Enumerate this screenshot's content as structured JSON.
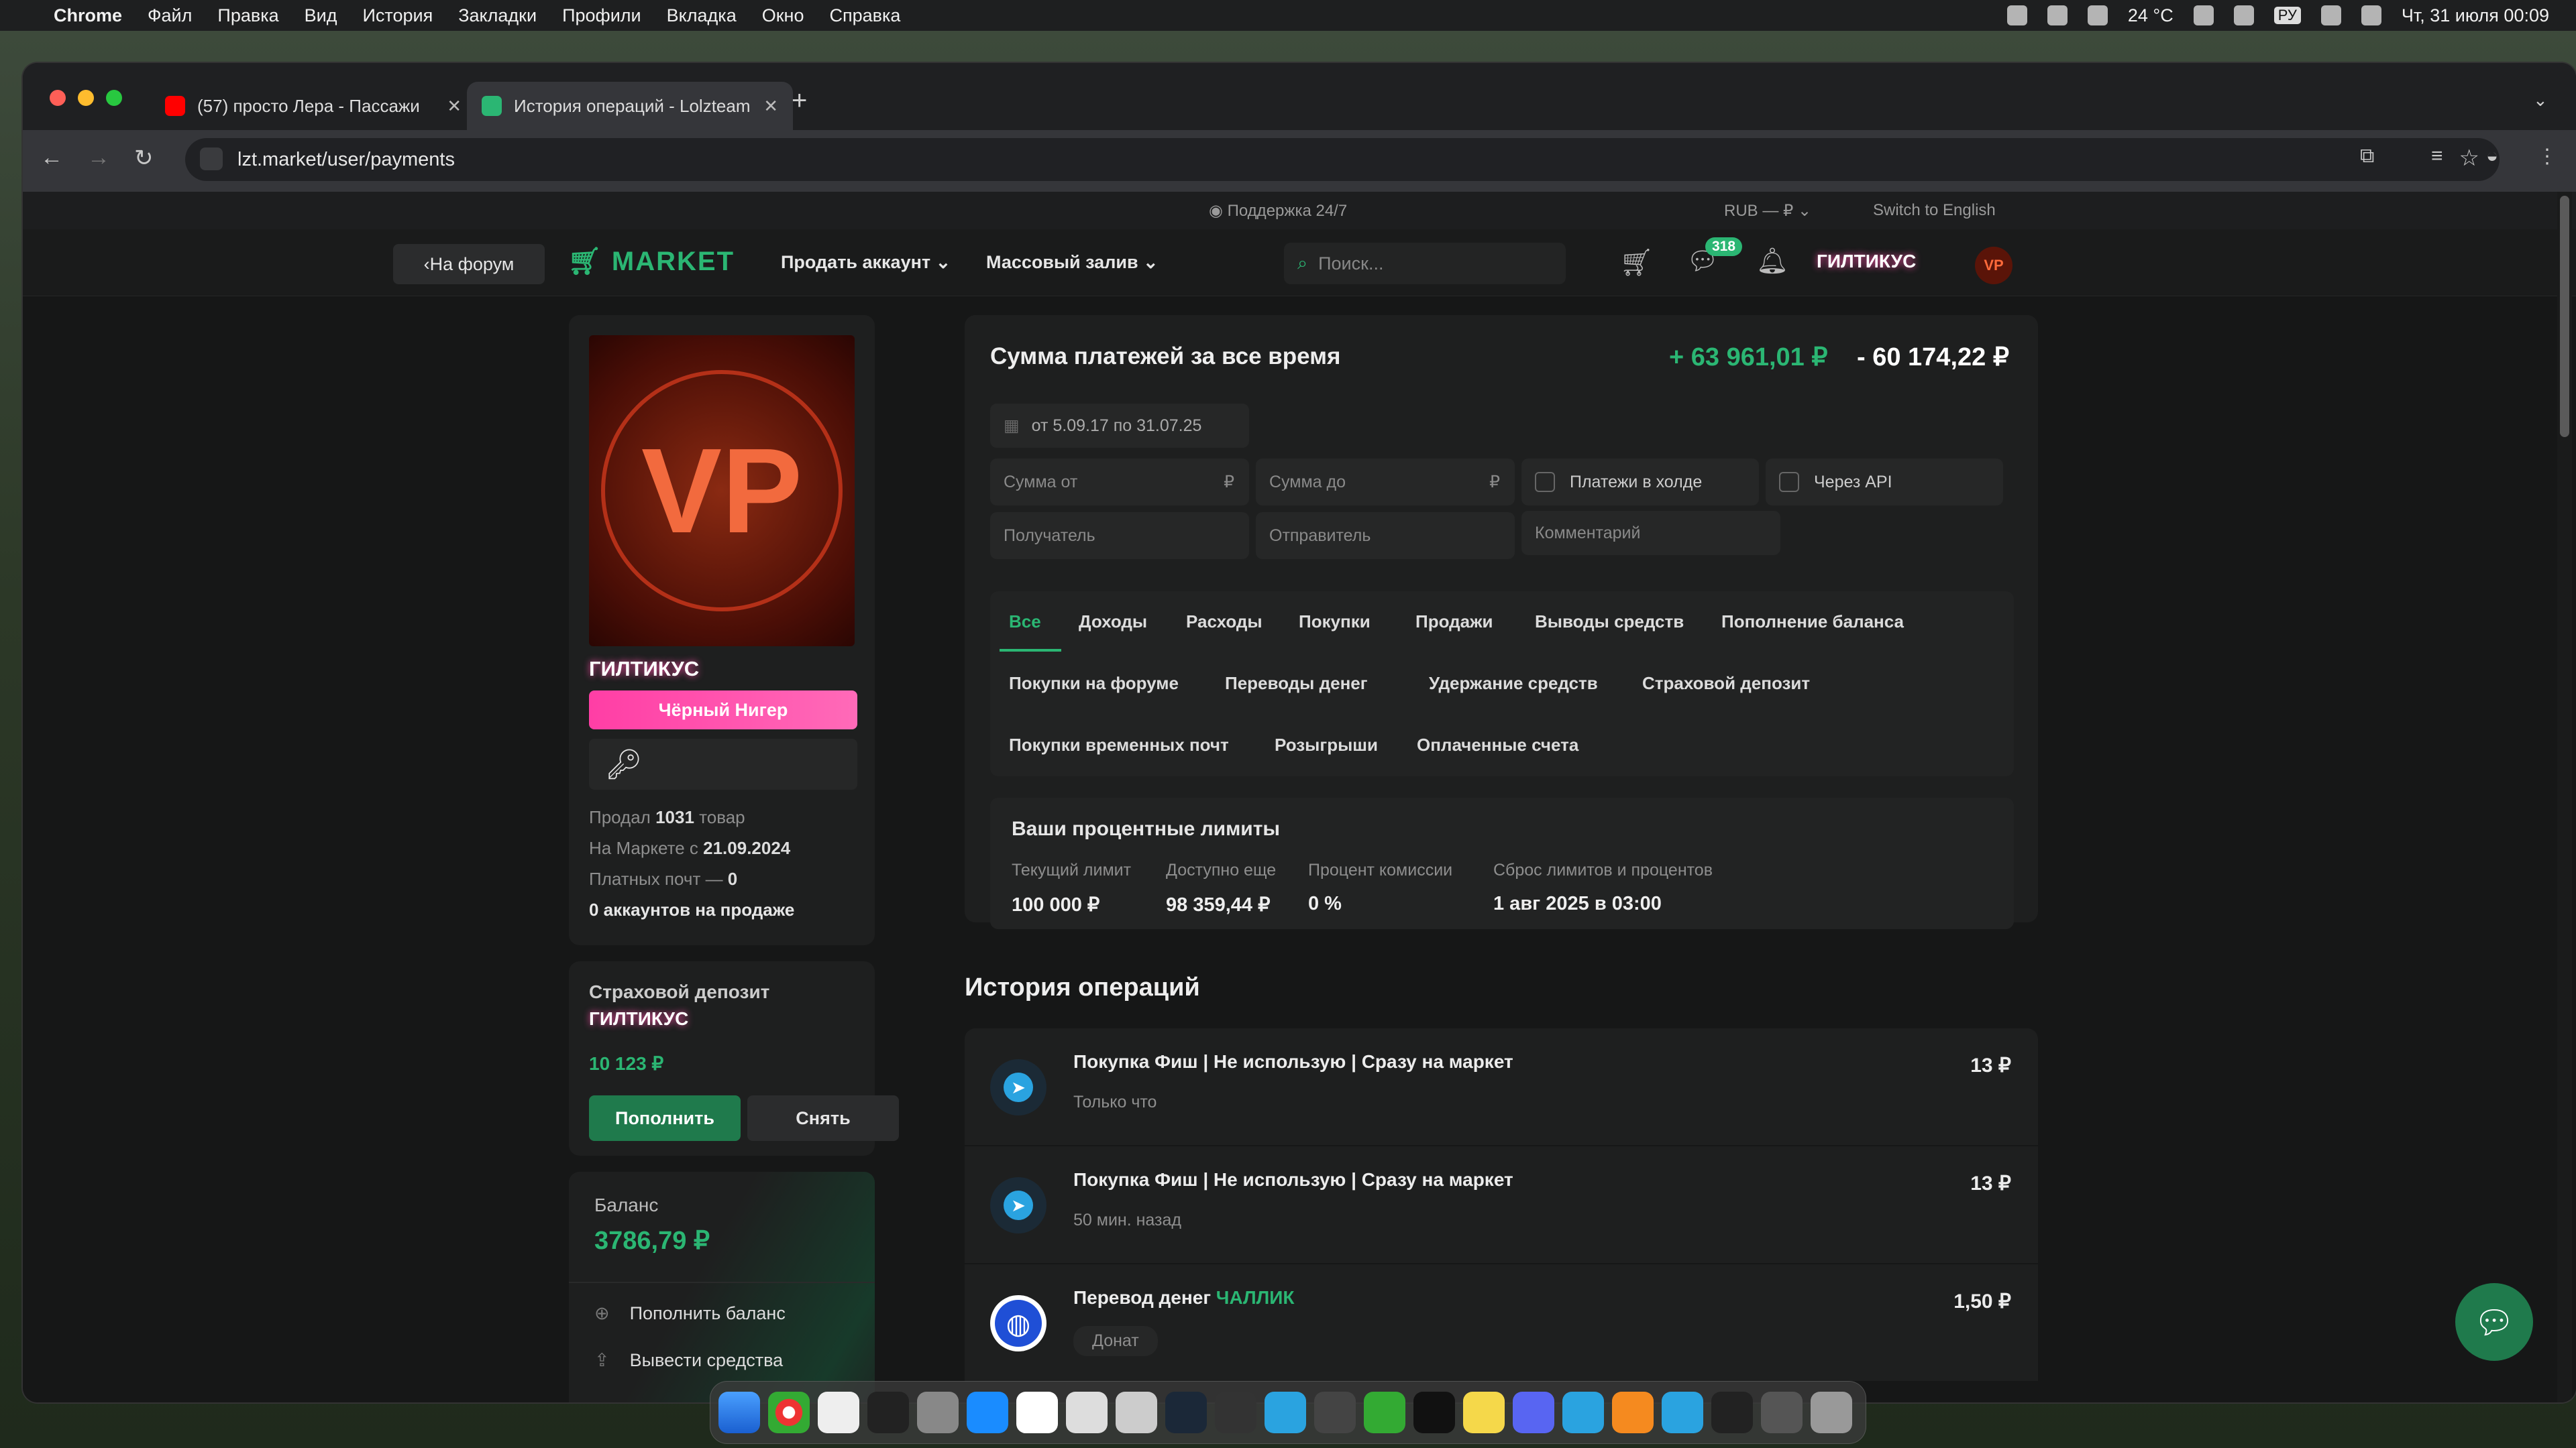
{
  "menubar": {
    "app": "Chrome",
    "items": [
      "Файл",
      "Правка",
      "Вид",
      "История",
      "Закладки",
      "Профили",
      "Вкладка",
      "Окно",
      "Справка"
    ],
    "weather": "24 °C",
    "keyboard": "РУ",
    "datetime": "Чт, 31 июля  00:09"
  },
  "browser": {
    "tabs": [
      {
        "title": "(57) просто Лера - Пассажи",
        "favicon": "youtube-icon"
      },
      {
        "title": "История операций - Lolzteam",
        "favicon": "market-icon"
      }
    ],
    "url": "lzt.market/user/payments"
  },
  "topstrip": {
    "support": "Поддержка 24/7",
    "currency": "RUB — ₽",
    "language": "Switch to English"
  },
  "header": {
    "back_label": "На форум",
    "logo": "MARKET",
    "nav": [
      "Продать аккаунт",
      "Массовый залив"
    ],
    "search_placeholder": "Поиск...",
    "messages_count": "318",
    "username": "ГИЛТИКУС"
  },
  "profile": {
    "avatar_text": "VP",
    "username": "ГИЛТИКУС",
    "badge": "Чёрный Нигер",
    "sold_prefix": "Продал ",
    "sold_count": "1031",
    "sold_suffix": " товар",
    "since_prefix": "На Маркете с ",
    "since_date": "21.09.2024",
    "paid_mails": "Платных почт — ",
    "paid_mails_count": "0",
    "accounts_on_sale": "0 аккаунтов на продаже"
  },
  "deposit": {
    "title": "Страховой депозит",
    "username": "ГИЛТИКУС",
    "amount": "10 123 ₽",
    "topup_label": "Пополнить",
    "withdraw_label": "Снять"
  },
  "balance": {
    "label": "Баланс",
    "amount": "3786,79 ₽",
    "actions": [
      "Пополнить баланс",
      "Вывести средства"
    ]
  },
  "summary": {
    "title": "Сумма платежей за все время",
    "income": "+ 63 961,01 ₽",
    "expense": "- 60 174,22 ₽",
    "date_range": "от 5.09.17 по 31.07.25",
    "amount_from": "Сумма от",
    "amount_to": "Сумма до",
    "currency_sign": "₽",
    "hold_label": "Платежи в холде",
    "api_label": "Через API",
    "recipient": "Получатель",
    "sender": "Отправитель",
    "comment": "Комментарий"
  },
  "filter_tabs": {
    "row1": [
      "Все",
      "Доходы",
      "Расходы",
      "Покупки",
      "Продажи",
      "Выводы средств",
      "Пополнение баланса"
    ],
    "row2": [
      "Покупки на форуме",
      "Переводы денег",
      "Удержание средств",
      "Страховой депозит"
    ],
    "row3": [
      "Покупки временных почт",
      "Розыгрыши",
      "Оплаченные счета"
    ]
  },
  "limits": {
    "title": "Ваши процентные лимиты",
    "cols": [
      {
        "label": "Текущий лимит",
        "value": "100 000 ₽"
      },
      {
        "label": "Доступно еще",
        "value": "98 359,44 ₽"
      },
      {
        "label": "Процент комиссии",
        "value": "0 %"
      },
      {
        "label": "Сброс лимитов и процентов",
        "value": "1 авг 2025 в 03:00"
      }
    ]
  },
  "history": {
    "title": "История операций",
    "ops": [
      {
        "title": "Покупка Фиш | Не использую | Сразу на маркет",
        "sub": "Только что",
        "amount": "13 ₽"
      },
      {
        "title": "Покупка Фиш | Не использую | Сразу на маркет",
        "sub": "50 мин. назад",
        "amount": "13 ₽"
      },
      {
        "title": "Перевод денег ",
        "user": "ЧАЛЛИК",
        "sub": "Донат",
        "amount": "1,50 ₽"
      }
    ]
  },
  "colors": {
    "accent": "#2bb673",
    "badge": "#ff3ea5",
    "avatar_bg": "#5a1408"
  }
}
